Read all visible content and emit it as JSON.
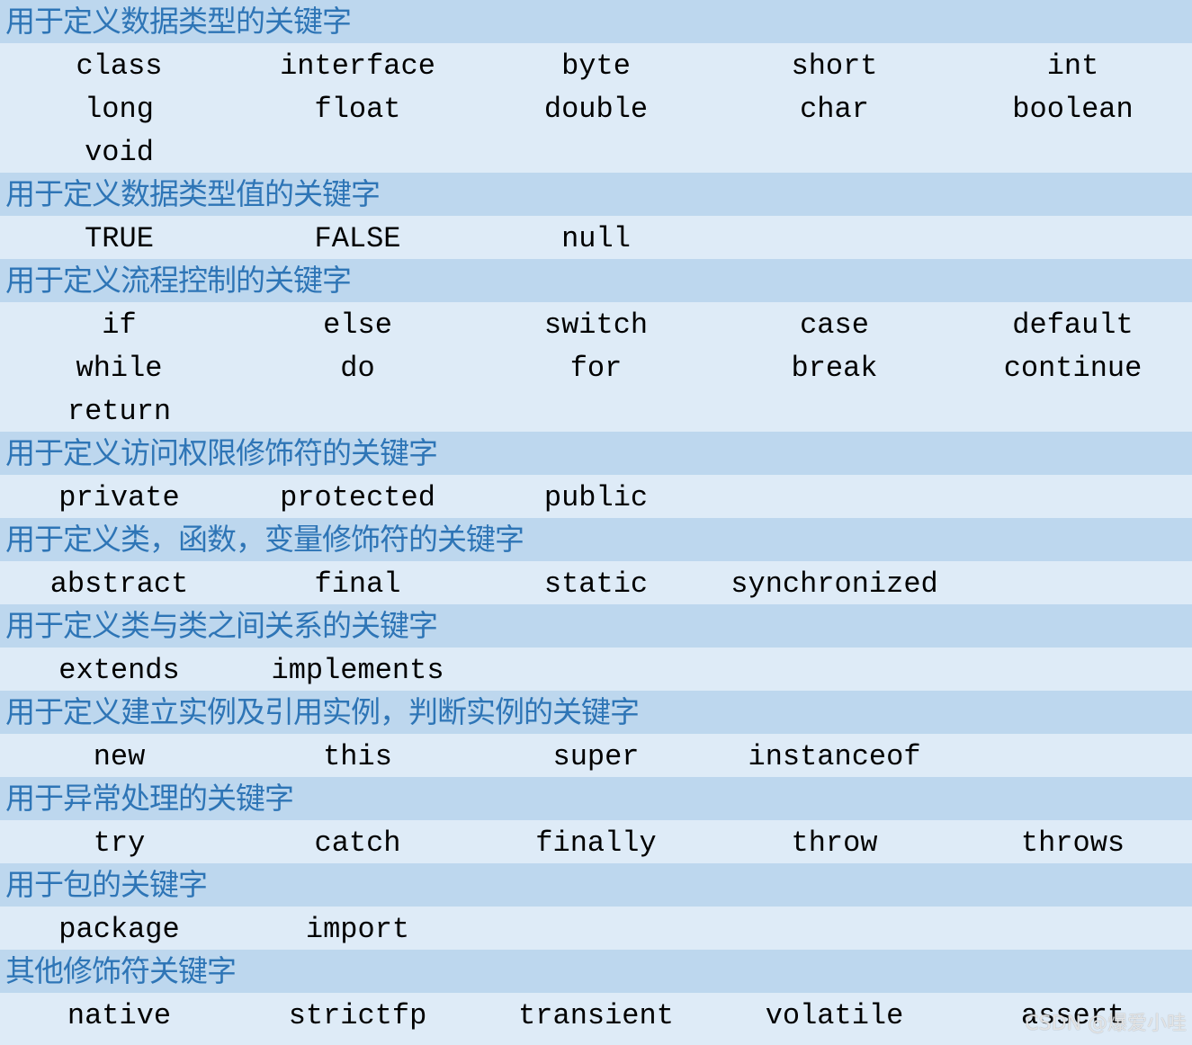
{
  "sections": [
    {
      "title": "用于定义数据类型的关键字",
      "rows": [
        [
          "class",
          "interface",
          "byte",
          "short",
          "int"
        ],
        [
          "long",
          "float",
          "double",
          "char",
          "boolean"
        ],
        [
          "void"
        ]
      ]
    },
    {
      "title": "用于定义数据类型值的关键字",
      "rows": [
        [
          "TRUE",
          "FALSE",
          "null"
        ]
      ]
    },
    {
      "title": "用于定义流程控制的关键字",
      "rows": [
        [
          "if",
          "else",
          "switch",
          "case",
          "default"
        ],
        [
          "while",
          "do",
          "for",
          "break",
          "continue"
        ],
        [
          "return"
        ]
      ]
    },
    {
      "title": "用于定义访问权限修饰符的关键字",
      "rows": [
        [
          "private",
          "protected",
          "public"
        ]
      ]
    },
    {
      "title": "用于定义类，函数，变量修饰符的关键字",
      "rows": [
        [
          "abstract",
          "final",
          "static",
          "synchronized"
        ]
      ]
    },
    {
      "title": "用于定义类与类之间关系的关键字",
      "rows": [
        [
          "extends",
          "implements"
        ]
      ]
    },
    {
      "title": "用于定义建立实例及引用实例，判断实例的关键字",
      "rows": [
        [
          "new",
          "this",
          "super",
          "instanceof"
        ]
      ]
    },
    {
      "title": "用于异常处理的关键字",
      "rows": [
        [
          "try",
          "catch",
          "finally",
          "throw",
          "throws"
        ]
      ]
    },
    {
      "title": "用于包的关键字",
      "rows": [
        [
          "package",
          "import"
        ]
      ]
    },
    {
      "title": "其他修饰符关键字",
      "rows": [
        [
          "native",
          "strictfp",
          "transient",
          "volatile",
          "assert"
        ]
      ]
    }
  ],
  "watermark": "CSDN @爆爱小哇",
  "colors": {
    "header_bg": "#bdd7ee",
    "header_text": "#2e75b6",
    "row_bg": "#deebf7"
  }
}
